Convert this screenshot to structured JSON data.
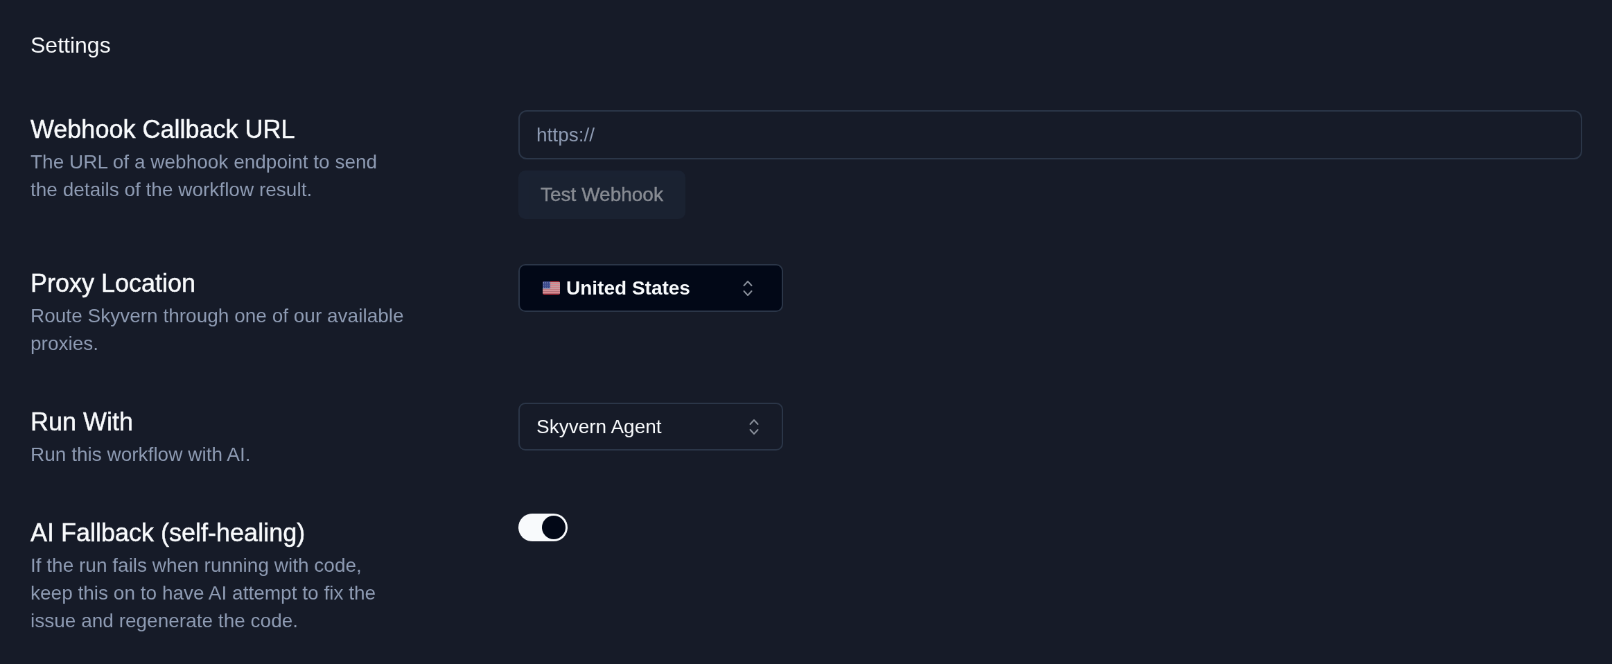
{
  "title": "Settings",
  "settings": [
    {
      "kind": "url",
      "label": "Webhook Callback URL",
      "description": "The URL of a webhook endpoint to send the details of the workflow result.",
      "field": {
        "placeholder": "https://"
      },
      "button": {
        "label": "Test Webhook",
        "disabled": true
      }
    },
    {
      "kind": "location-select",
      "label": "Proxy Location",
      "description": "Route Skyvern through one of our available proxies.",
      "value": "United States"
    },
    {
      "kind": "select",
      "label": "Run With",
      "description": "Run this workflow with AI.",
      "value": "Skyvern Agent"
    },
    {
      "kind": "toggle",
      "label": "AI Fallback (self-healing)",
      "description": "If the run fails when running with code, keep this on to have AI attempt to fix the issue and regenerate the code.",
      "on": true
    }
  ]
}
